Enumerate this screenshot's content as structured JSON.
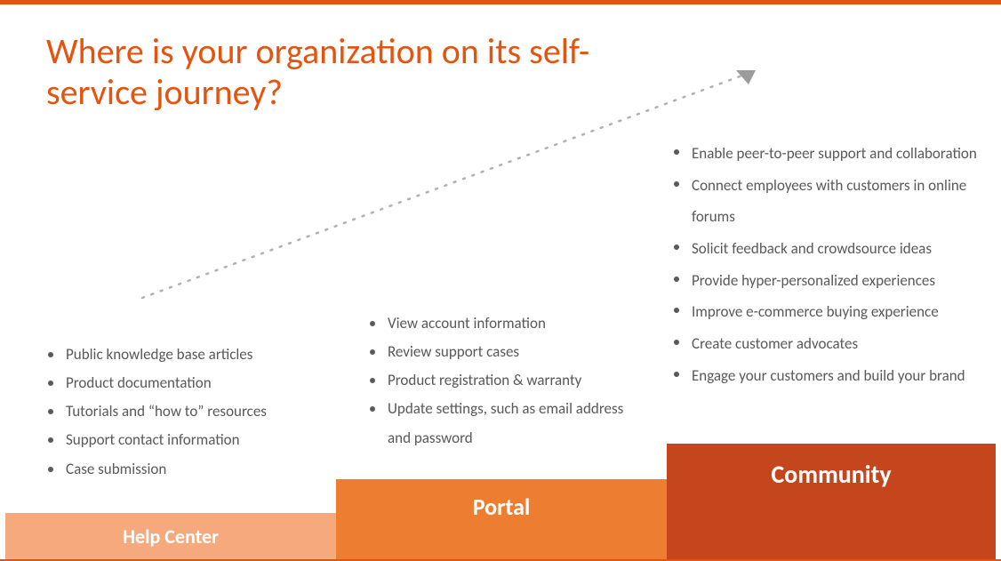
{
  "title": "Where is your organization on its self-service journey?",
  "columns": [
    {
      "label": "Help Center",
      "items": [
        "Public knowledge base articles",
        "Product documentation",
        "Tutorials and “how to” resources",
        "Support contact information",
        "Case submission"
      ]
    },
    {
      "label": "Portal",
      "items": [
        "View account information",
        "Review support cases",
        "Product registration & warranty",
        "Update settings, such as email address and password"
      ]
    },
    {
      "label": "Community",
      "items": [
        "Enable peer-to-peer support and collaboration",
        "Connect employees with customers in online forums",
        "Solicit feedback and crowdsource ideas",
        "Provide hyper-personalized experiences",
        "Improve e-commerce buying experience",
        "Create customer advocates",
        "Engage your customers and build your brand"
      ]
    }
  ]
}
